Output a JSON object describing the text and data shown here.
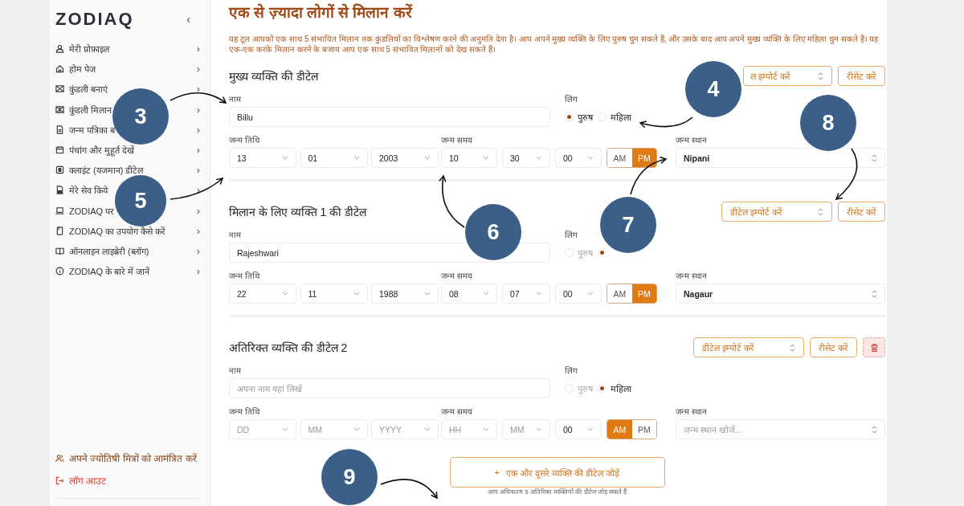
{
  "sidebar": {
    "logo": "ZODIAQ",
    "collapse": "‹",
    "items": [
      {
        "label": "मेरी प्रोफ़ाइल",
        "chevron": "›"
      },
      {
        "label": "होम पेज",
        "chevron": "›"
      },
      {
        "label": "कुंडली बनाएं",
        "chevron": "›"
      },
      {
        "label": "कुंडली मिलान",
        "chevron": "›"
      },
      {
        "label": "जन्म पत्रिका ब",
        "chevron": "›"
      },
      {
        "label": "पंचांग और मुहूर्त देखें",
        "chevron": "›"
      },
      {
        "label": "क्लाइंट (यजमान) डीटेल",
        "chevron": "›"
      },
      {
        "label": "मेरे सेव किये",
        "chevron": "›"
      },
      {
        "label": "ZODIAQ पर",
        "chevron": "›"
      },
      {
        "label": "ZODIAQ का उपयोग कैसे करें",
        "chevron": "›"
      },
      {
        "label": "ऑनलाइन लाइब्रेरी (ब्लॉग)",
        "chevron": "›"
      },
      {
        "label": "ZODIAQ के बारे में जानें",
        "chevron": "›"
      }
    ],
    "footer": [
      {
        "kind": "invite",
        "label": "अपने ज्योतिषी मित्रों को आमंत्रित करें"
      },
      {
        "kind": "logout",
        "label": "लॉग आउट"
      }
    ]
  },
  "page": {
    "title": "एक से ज़्यादा लोगों से मिलान करें",
    "description": "यह टूल आपको एक साथ 5 संभावित मिलान तक कुंडलियों का विश्लेषण करने की अनुमति देता है। आप अपने मुख्य व्यक्ति के लिए पुरुष चुन सकते हैं, और उसके बाद आप अपने मुख्य व्यक्ति के लिए महिला चुन सकते हैं। यह एक-एक करके मिलान करने के बजाय आप एक साथ 5 संभावित मिलानों को देख सकते हैं।"
  },
  "sections": [
    {
      "title": "मुख्य व्यक्ति की डीटेल",
      "import_label": "ल इम्पोर्ट करें",
      "reset_label": "रीसेट करें",
      "deletable": false,
      "name": {
        "label": "नाम",
        "value": "Billu"
      },
      "gender": {
        "label": "लिंग",
        "options": [
          {
            "label": "पुरुष",
            "selected": true,
            "disabled": false
          },
          {
            "label": "महिला",
            "selected": false,
            "disabled": false
          }
        ]
      },
      "dob": {
        "label": "जन्म तिथि",
        "fields": [
          {
            "value": "13"
          },
          {
            "value": "01"
          },
          {
            "value": "2003"
          }
        ]
      },
      "time": {
        "label": "जन्म समय",
        "fields": [
          {
            "value": "10"
          },
          {
            "value": "30"
          },
          {
            "value": "00"
          }
        ],
        "ampm": [
          {
            "label": "AM",
            "selected": false
          },
          {
            "label": "PM",
            "selected": true
          }
        ]
      },
      "place": {
        "label": "जन्म स्थान",
        "value": "Nipani"
      }
    },
    {
      "title": "मिलान के लिए व्यक्ति 1 की डीटेल",
      "import_label": "डीटेल इम्पोर्ट करें",
      "reset_label": "रीसेट करें",
      "deletable": false,
      "name": {
        "label": "नाम",
        "value": "Rajeshwari"
      },
      "gender": {
        "label": "लिंग",
        "options": [
          {
            "label": "पुरुष",
            "selected": false,
            "disabled": true
          },
          {
            "selected": true
          }
        ]
      },
      "dob": {
        "label": "जन्म तिथि",
        "fields": [
          {
            "value": "22"
          },
          {
            "value": "11"
          },
          {
            "value": "1988"
          }
        ]
      },
      "time": {
        "label": "जन्म समय",
        "fields": [
          {
            "value": "08"
          },
          {
            "value": "07"
          },
          {
            "value": "00"
          }
        ],
        "ampm": [
          {
            "label": "AM",
            "selected": false
          },
          {
            "label": "PM",
            "selected": true
          }
        ]
      },
      "place": {
        "label": "जन्म स्थान",
        "value": "Nagaur"
      }
    },
    {
      "title": "अतिरिक्त व्यक्ति की डीटेल 2",
      "import_label": "डीटेल इम्पोर्ट करें",
      "reset_label": "रीसेट करें",
      "deletable": true,
      "name": {
        "label": "नाम",
        "placeholder": "अपना नाम यहां लिखें"
      },
      "gender": {
        "label": "लिंग",
        "options": [
          {
            "label": "पुरुष",
            "selected": false,
            "disabled": true
          },
          {
            "label": "महिला",
            "selected": true,
            "disabled": false
          }
        ]
      },
      "dob": {
        "label": "जन्म तिथि",
        "fields": [
          {
            "placeholder": "DD"
          },
          {
            "placeholder": "MM"
          },
          {
            "placeholder": "YYYY"
          }
        ]
      },
      "time": {
        "label": "जन्म समय",
        "fields": [
          {
            "placeholder": "HH"
          },
          {
            "placeholder": "MM"
          },
          {
            "value": "00"
          }
        ],
        "ampm": [
          {
            "label": "AM",
            "selected": true
          },
          {
            "label": "PM",
            "selected": false
          }
        ]
      },
      "place": {
        "label": "जन्म स्थान",
        "placeholder": "जन्म स्थान खोजें..."
      }
    }
  ],
  "add_button": {
    "icon": "+",
    "label": "एक और दूसरे व्यक्ति की डीटेल जोड़ें"
  },
  "note": "आप अधिकतम 5 अतिरिक्त व्यक्तियों की डीटेल जोड़ सकते हैं",
  "annotations": [
    {
      "label": "3"
    },
    {
      "label": "4"
    },
    {
      "label": "5"
    },
    {
      "label": "6"
    },
    {
      "label": "7"
    },
    {
      "label": "8"
    },
    {
      "label": "9"
    }
  ]
}
